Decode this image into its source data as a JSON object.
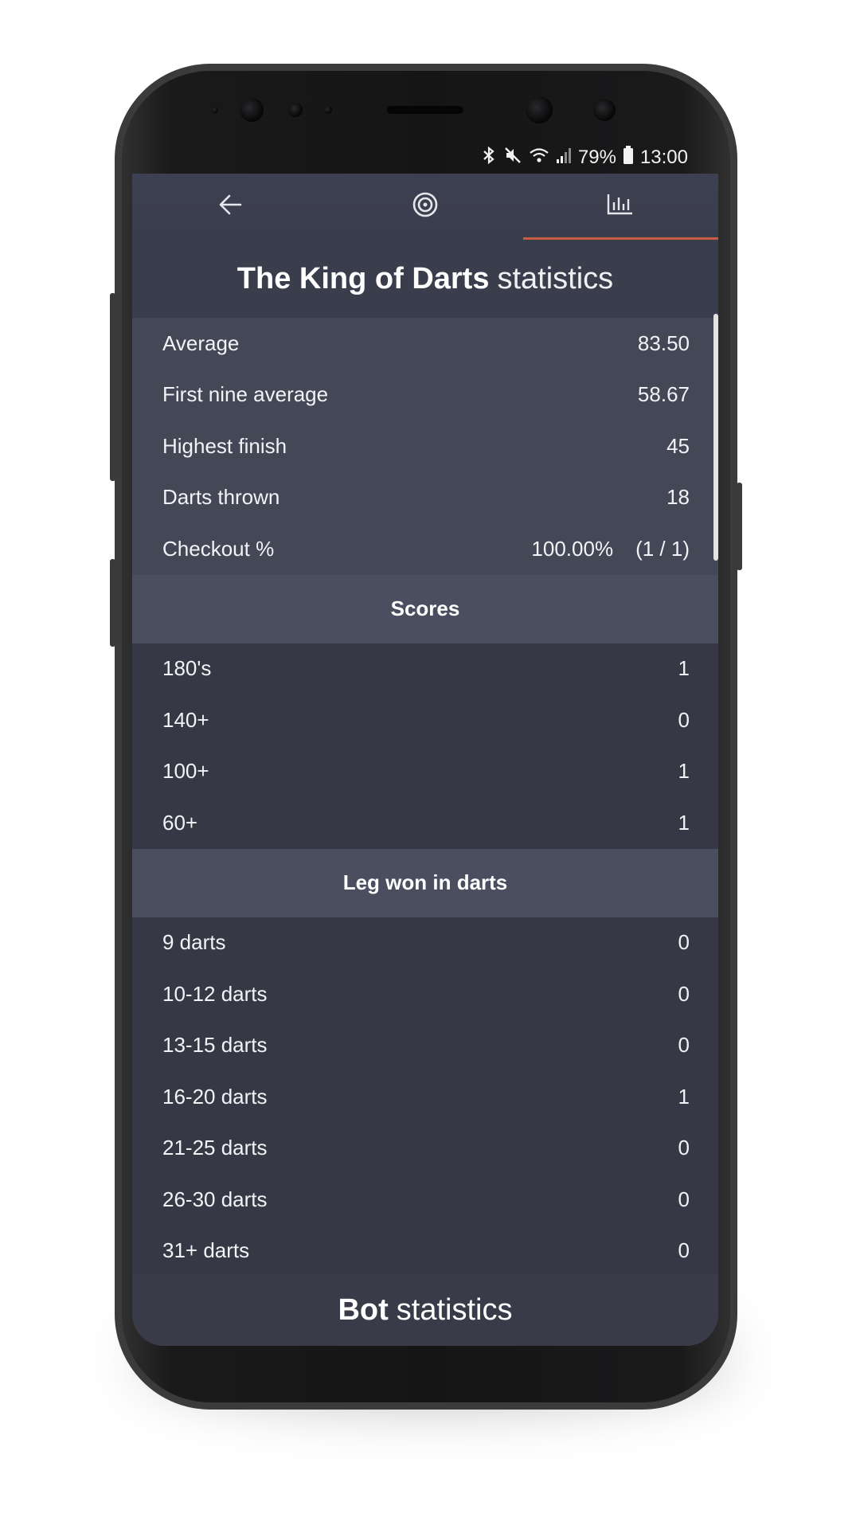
{
  "status_bar": {
    "battery": "79%",
    "time": "13:00",
    "icons": [
      "bluetooth-icon",
      "mute-icon",
      "wifi-icon",
      "signal-icon",
      "battery-icon"
    ]
  },
  "toolbar": {
    "tabs": [
      {
        "icon": "back-arrow-icon"
      },
      {
        "icon": "dartboard-target-icon"
      },
      {
        "icon": "bar-chart-icon",
        "active": true
      }
    ],
    "accent_color": "#c75b44"
  },
  "player_title": {
    "name": "The King of Darts",
    "suffix": "statistics"
  },
  "summary": [
    {
      "label": "Average",
      "value": "83.50"
    },
    {
      "label": "First nine average",
      "value": "58.67"
    },
    {
      "label": "Highest finish",
      "value": "45"
    },
    {
      "label": "Darts thrown",
      "value": "18"
    },
    {
      "label": "Checkout %",
      "value": "100.00%",
      "extra": "(1 / 1)"
    }
  ],
  "scores": {
    "header": "Scores",
    "rows": [
      {
        "label": "180's",
        "value": "1"
      },
      {
        "label": "140+",
        "value": "0"
      },
      {
        "label": "100+",
        "value": "1"
      },
      {
        "label": "60+",
        "value": "1"
      }
    ]
  },
  "legs": {
    "header": "Leg won in darts",
    "rows": [
      {
        "label": "9 darts",
        "value": "0"
      },
      {
        "label": "10-12 darts",
        "value": "0"
      },
      {
        "label": "13-15 darts",
        "value": "0"
      },
      {
        "label": "16-20 darts",
        "value": "1"
      },
      {
        "label": "21-25 darts",
        "value": "0"
      },
      {
        "label": "26-30 darts",
        "value": "0"
      },
      {
        "label": "31+ darts",
        "value": "0"
      }
    ]
  },
  "bot_title": {
    "name": "Bot",
    "suffix": "statistics"
  }
}
